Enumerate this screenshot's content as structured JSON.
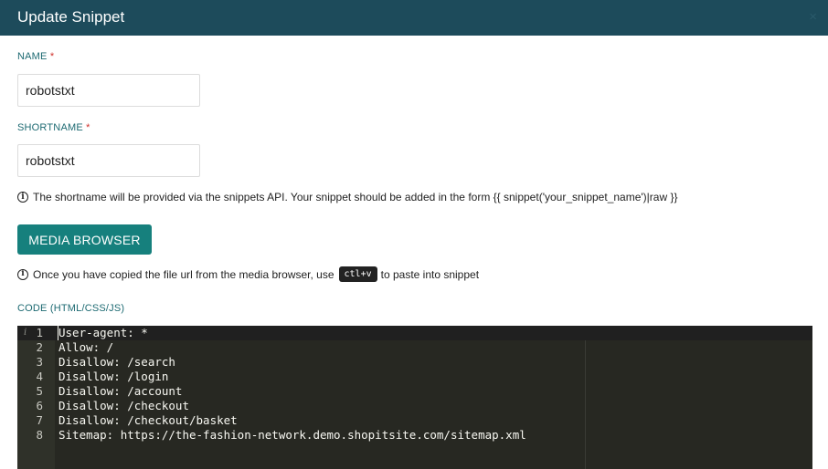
{
  "dialog": {
    "title": "Update Snippet",
    "close_label": "×"
  },
  "name_field": {
    "label": "NAME",
    "required_mark": "*",
    "value": "robotstxt"
  },
  "shortname_field": {
    "label": "SHORTNAME",
    "required_mark": "*",
    "value": "robotstxt"
  },
  "shortname_hint": "The shortname will be provided via the snippets API. Your snippet should be added in the form {{ snippet('your_snippet_name')|raw }}",
  "media_button_label": "MEDIA BROWSER",
  "media_hint": {
    "before": "Once you have copied the file url from the media browser, use",
    "shortcut": "ctl+v",
    "after": "to paste into snippet"
  },
  "code_label": "CODE (HTML/CSS/JS)",
  "editor": {
    "gutter_info": "i",
    "lines": [
      {
        "num": "1",
        "text": "User-agent: *"
      },
      {
        "num": "2",
        "text": "Allow: /"
      },
      {
        "num": "3",
        "text": "Disallow: /search"
      },
      {
        "num": "4",
        "text": "Disallow: /login"
      },
      {
        "num": "5",
        "text": "Disallow: /account"
      },
      {
        "num": "6",
        "text": "Disallow: /checkout"
      },
      {
        "num": "7",
        "text": "Disallow: /checkout/basket"
      },
      {
        "num": "8",
        "text": "Sitemap: https://the-fashion-network.demo.shopitsite.com/sitemap.xml"
      }
    ]
  },
  "colors": {
    "header_bg": "#1d4b5b",
    "accent_button": "#16807d",
    "label": "#1d6a72",
    "required": "#d0302b",
    "editor_bg": "#272822"
  }
}
